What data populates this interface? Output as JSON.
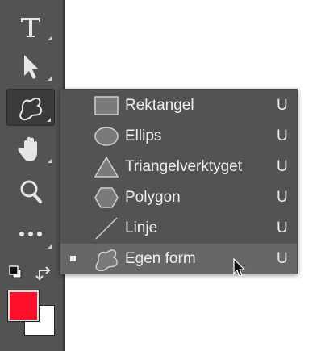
{
  "toolbar": {
    "tools": [
      {
        "name": "type-tool",
        "icon": "type-icon"
      },
      {
        "name": "path-selection-tool",
        "icon": "arrow-pointer-icon"
      },
      {
        "name": "custom-shape-tool",
        "icon": "custom-shape-icon",
        "active": true
      },
      {
        "name": "hand-tool",
        "icon": "hand-icon"
      },
      {
        "name": "zoom-tool",
        "icon": "magnifier-icon"
      },
      {
        "name": "edit-toolbar",
        "icon": "ellipsis-icon"
      }
    ],
    "foreground_color": "#ff0e2a",
    "background_color": "#ffffff"
  },
  "flyout": {
    "items": [
      {
        "label": "Rektangel",
        "shortcut": "U",
        "icon": "rectangle-icon"
      },
      {
        "label": "Ellips",
        "shortcut": "U",
        "icon": "ellipse-icon"
      },
      {
        "label": "Triangelverktyget",
        "shortcut": "U",
        "icon": "triangle-icon"
      },
      {
        "label": "Polygon",
        "shortcut": "U",
        "icon": "polygon-icon"
      },
      {
        "label": "Linje",
        "shortcut": "U",
        "icon": "line-icon"
      },
      {
        "label": "Egen form",
        "shortcut": "U",
        "icon": "custom-shape-icon",
        "selected": true
      }
    ]
  }
}
